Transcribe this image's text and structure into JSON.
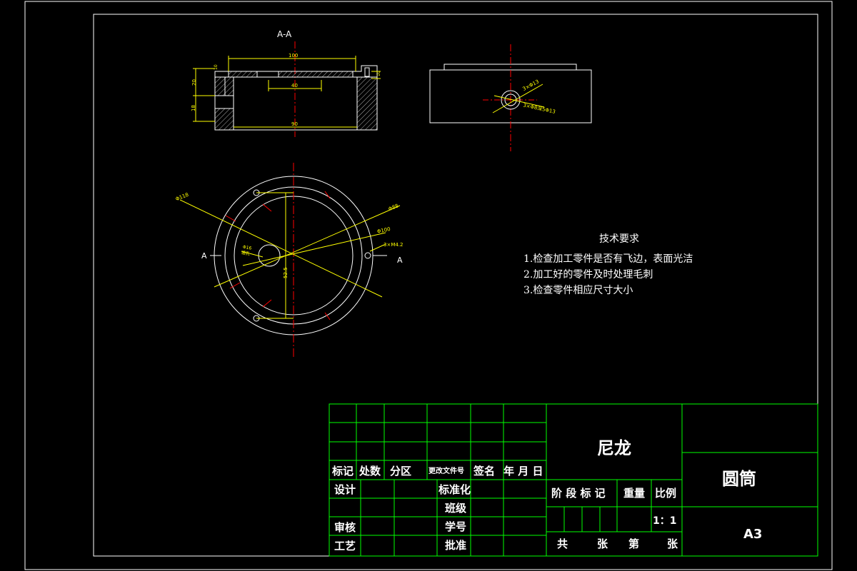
{
  "section_label": "A-A",
  "section_marks": {
    "left": "A",
    "right": "A"
  },
  "dimensions": {
    "top_width": "100",
    "inner_width": "40",
    "bottom_width": "90",
    "left_upper": "20",
    "left_lower": "18",
    "left_top": "10",
    "right_small": "10",
    "slot_callout": "3×Φ13",
    "slot_callout2": "3×Φ8深5Φ13",
    "dia_outer": "Φ118",
    "dia_88": "Φ88",
    "dia_100": "Φ100",
    "threads": "3×M4.2",
    "hole_dia": "Φ16",
    "hole_depth": "通孔",
    "vertical_dim": "52.5"
  },
  "tech_requirements": {
    "title": "技术要求",
    "items": [
      "1.检查加工零件是否有飞边，表面光洁",
      "2.加工好的零件及时处理毛刺",
      "3.检查零件相应尺寸大小"
    ]
  },
  "title_block": {
    "material": "尼龙",
    "part_name": "圆筒",
    "sheet_size": "A3",
    "scale": "1：1",
    "row_headers": [
      "标记",
      "处数",
      "分区",
      "更改文件号",
      "签名",
      "年 月 日"
    ],
    "sig_labels_left": [
      "设计",
      "审核",
      "工艺"
    ],
    "sig_labels_mid": [
      "标准化",
      "班级",
      "学号",
      "批准"
    ],
    "stage_labels": [
      "阶 段 标 记",
      "重量",
      "比例"
    ],
    "sheet_count": [
      "共",
      "张",
      "第",
      "张"
    ]
  },
  "colors": {
    "border": "#ffffff",
    "titleblock_lines": "#00ff00",
    "geometry": "#ffffff",
    "dimension": "#ffff00",
    "centerline": "#ff0000"
  }
}
